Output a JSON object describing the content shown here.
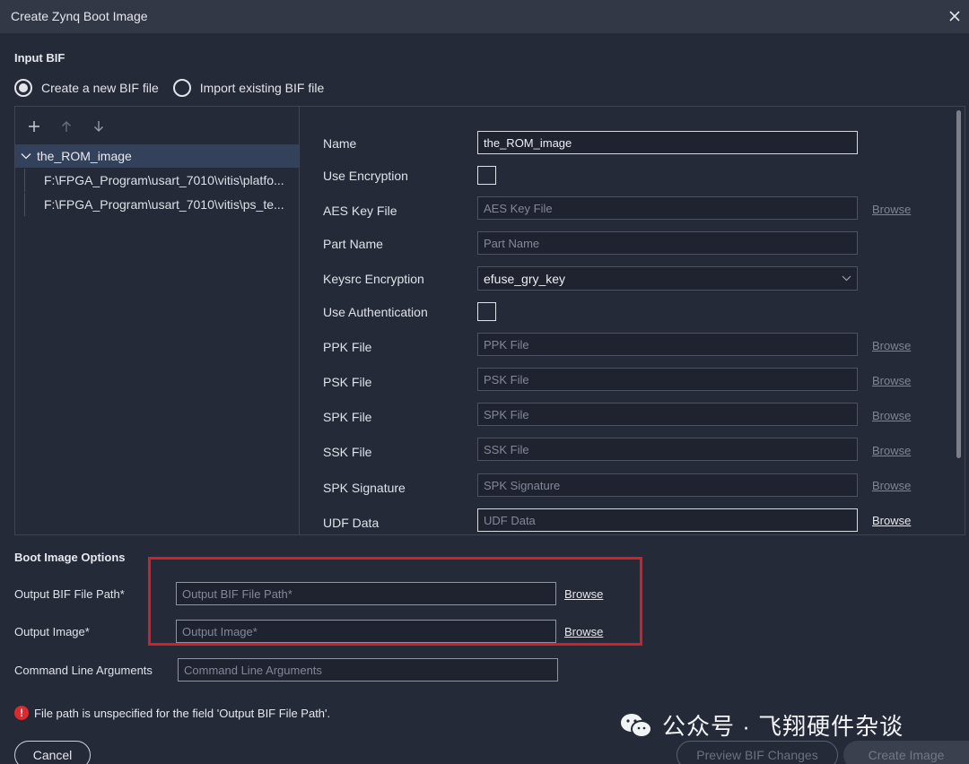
{
  "window": {
    "title": "Create Zynq Boot Image"
  },
  "input_bif": {
    "heading": "Input BIF",
    "options": [
      {
        "label": "Create a new BIF file",
        "selected": true
      },
      {
        "label": "Import existing BIF file",
        "selected": false
      }
    ]
  },
  "tree": {
    "root": "the_ROM_image",
    "children": [
      "F:\\FPGA_Program\\usart_7010\\vitis\\platfo...",
      "F:\\FPGA_Program\\usart_7010\\vitis\\ps_te..."
    ]
  },
  "form": {
    "name": {
      "label": "Name",
      "value": "the_ROM_image"
    },
    "use_encryption": {
      "label": "Use Encryption"
    },
    "aes_key_file": {
      "label": "AES Key File",
      "placeholder": "AES Key File"
    },
    "part_name": {
      "label": "Part Name",
      "placeholder": "Part Name"
    },
    "keysrc_encryption": {
      "label": "Keysrc Encryption",
      "value": "efuse_gry_key"
    },
    "use_authentication": {
      "label": "Use Authentication"
    },
    "ppk_file": {
      "label": "PPK File",
      "placeholder": "PPK File"
    },
    "psk_file": {
      "label": "PSK File",
      "placeholder": "PSK File"
    },
    "spk_file": {
      "label": "SPK File",
      "placeholder": "SPK File"
    },
    "ssk_file": {
      "label": "SSK File",
      "placeholder": "SSK File"
    },
    "spk_signature": {
      "label": "SPK Signature",
      "placeholder": "SPK Signature"
    },
    "udf_data": {
      "label": "UDF Data",
      "placeholder": "UDF Data"
    },
    "browse_label": "Browse"
  },
  "boot_options": {
    "heading": "Boot Image Options",
    "output_bif": {
      "label": "Output BIF File Path*",
      "placeholder": "Output BIF File Path*"
    },
    "output_image": {
      "label": "Output Image*",
      "placeholder": "Output Image*"
    },
    "cmd_args": {
      "label": "Command Line Arguments",
      "placeholder": "Command Line Arguments"
    },
    "browse_label": "Browse"
  },
  "error": {
    "icon": "!",
    "text": "File path is unspecified for the field 'Output BIF File Path'."
  },
  "buttons": {
    "cancel": "Cancel",
    "preview": "Preview BIF Changes",
    "create": "Create Image"
  },
  "watermark": {
    "text": "公众号 · 飞翔硬件杂谈"
  },
  "colors": {
    "accent_error": "#d0202a",
    "background": "#252a38",
    "titlebar": "#323846"
  }
}
